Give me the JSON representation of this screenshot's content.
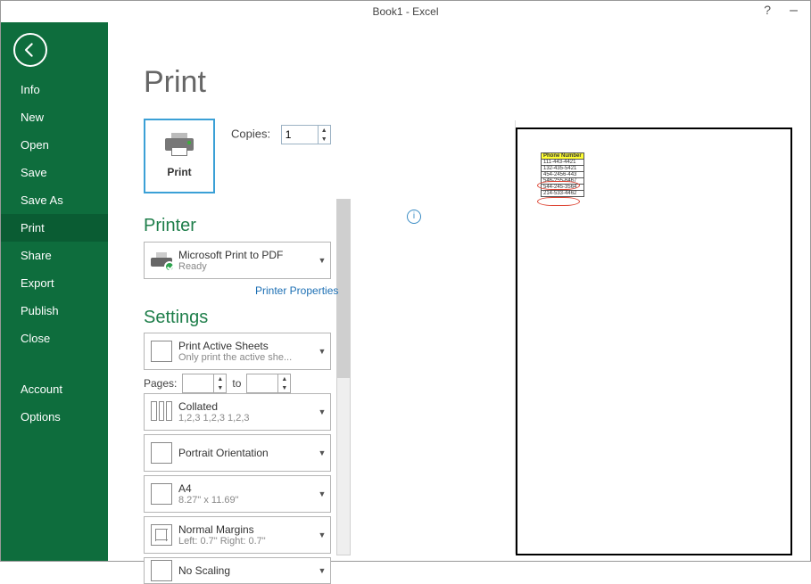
{
  "window": {
    "title": "Book1 - Excel"
  },
  "sidebar": {
    "back": "Back",
    "items": [
      {
        "label": "Info"
      },
      {
        "label": "New"
      },
      {
        "label": "Open"
      },
      {
        "label": "Save"
      },
      {
        "label": "Save As"
      },
      {
        "label": "Print",
        "selected": true
      },
      {
        "label": "Share"
      },
      {
        "label": "Export"
      },
      {
        "label": "Publish"
      },
      {
        "label": "Close"
      }
    ],
    "bottom": [
      {
        "label": "Account"
      },
      {
        "label": "Options"
      }
    ]
  },
  "page": {
    "title": "Print",
    "print_button": "Print",
    "copies_label": "Copies:",
    "copies_value": "1"
  },
  "printer": {
    "title": "Printer",
    "device": "Microsoft Print to PDF",
    "status": "Ready",
    "properties_link": "Printer Properties"
  },
  "settings": {
    "title": "Settings",
    "sheets": {
      "l1": "Print Active Sheets",
      "l2": "Only print the active she..."
    },
    "pages_label": "Pages:",
    "pages_from": "",
    "pages_to_label": "to",
    "pages_to": "",
    "collate": {
      "l1": "Collated",
      "l2": "1,2,3    1,2,3    1,2,3"
    },
    "orient": {
      "l1": "Portrait Orientation",
      "l2": ""
    },
    "paper": {
      "l1": "A4",
      "l2": "8.27\" x 11.69\""
    },
    "margins": {
      "l1": "Normal Margins",
      "l2": "Left:  0.7\"    Right:  0.7\""
    },
    "scaling": {
      "l1": "No Scaling",
      "l2": ""
    }
  },
  "preview": {
    "header": "Phone Number",
    "rows": [
      "111-443-4421",
      "132-435-5421",
      "454-2456-443",
      "546-255-6467",
      "544-245-3564",
      "214-533-4462"
    ]
  }
}
